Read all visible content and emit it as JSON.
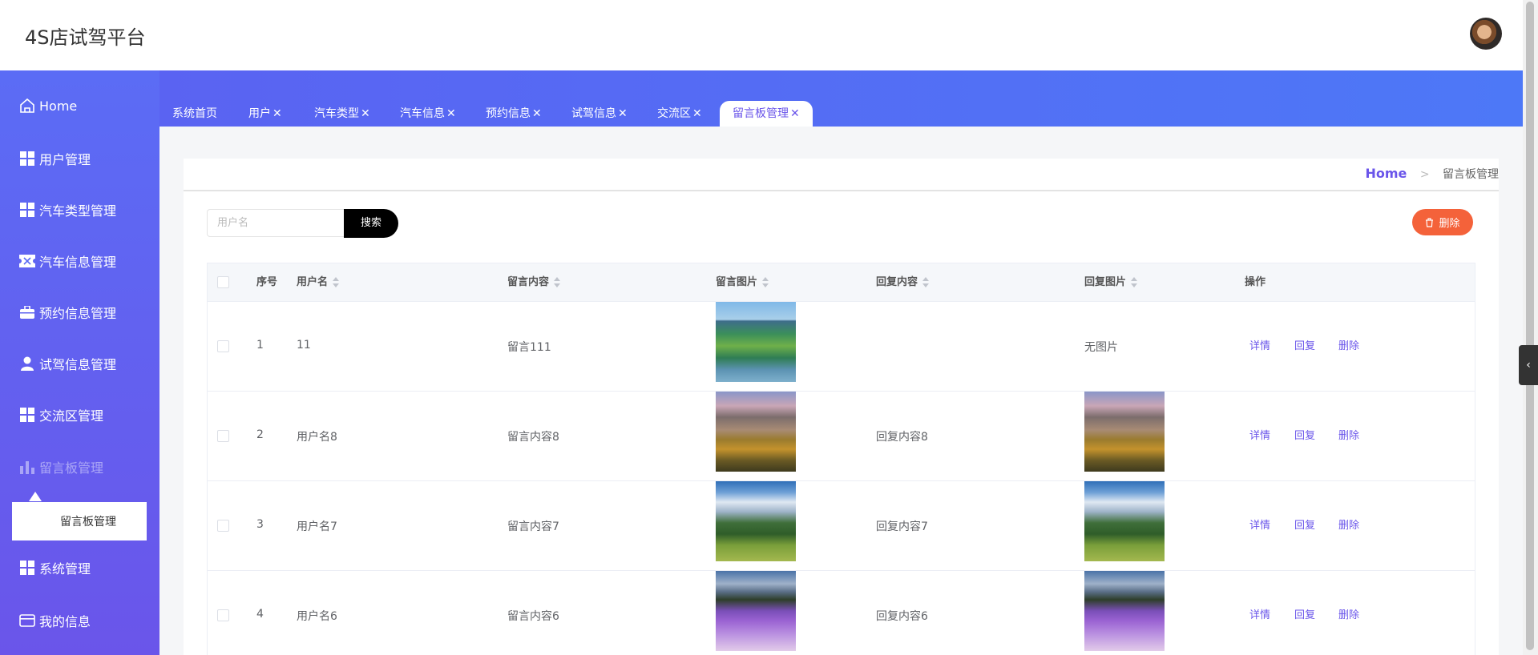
{
  "app": {
    "title": "4S店试驾平台"
  },
  "sidebar": {
    "items": [
      {
        "label": "Home",
        "icon": "home-icon"
      },
      {
        "label": "用户管理",
        "icon": "grid-icon"
      },
      {
        "label": "汽车类型管理",
        "icon": "grid-icon"
      },
      {
        "label": "汽车信息管理",
        "icon": "ticket-icon"
      },
      {
        "label": "预约信息管理",
        "icon": "briefcase-icon"
      },
      {
        "label": "试驾信息管理",
        "icon": "person-icon"
      },
      {
        "label": "交流区管理",
        "icon": "grid-icon"
      },
      {
        "label": "留言板管理",
        "icon": "bar-chart-icon"
      },
      {
        "label": "系统管理",
        "icon": "grid-icon"
      },
      {
        "label": "我的信息",
        "icon": "card-icon"
      }
    ],
    "submenu_label": "留言板管理"
  },
  "tabs": [
    {
      "label": "系统首页"
    },
    {
      "label": "用户"
    },
    {
      "label": "汽车类型"
    },
    {
      "label": "汽车信息"
    },
    {
      "label": "预约信息"
    },
    {
      "label": "试驾信息"
    },
    {
      "label": "交流区"
    },
    {
      "label": "留言板管理"
    }
  ],
  "tab_close": "✕",
  "breadcrumb": {
    "home": "Home",
    "sep": ">",
    "current": "留言板管理"
  },
  "search": {
    "placeholder": "用户名",
    "button_label": "搜索"
  },
  "delete_button_label": "删除",
  "table": {
    "headers": {
      "index": "序号",
      "username": "用户名",
      "content": "留言内容",
      "image": "留言图片",
      "reply": "回复内容",
      "reply_image": "回复图片",
      "actions": "操作"
    },
    "rows": [
      {
        "index": "1",
        "username": "11",
        "content": "留言111",
        "reply": "",
        "reply_image_text": "无图片"
      },
      {
        "index": "2",
        "username": "用户名8",
        "content": "留言内容8",
        "reply": "回复内容8",
        "reply_image_text": ""
      },
      {
        "index": "3",
        "username": "用户名7",
        "content": "留言内容7",
        "reply": "回复内容7",
        "reply_image_text": ""
      },
      {
        "index": "4",
        "username": "用户名6",
        "content": "留言内容6",
        "reply": "回复内容6",
        "reply_image_text": ""
      }
    ],
    "actions": {
      "detail": "详情",
      "reply": "回复",
      "delete": "删除"
    }
  },
  "colors": {
    "accent": "#6a55ea",
    "danger": "#f4623a",
    "sidebar_top": "#5b6cf5",
    "sidebar_bottom": "#6a55ea"
  }
}
